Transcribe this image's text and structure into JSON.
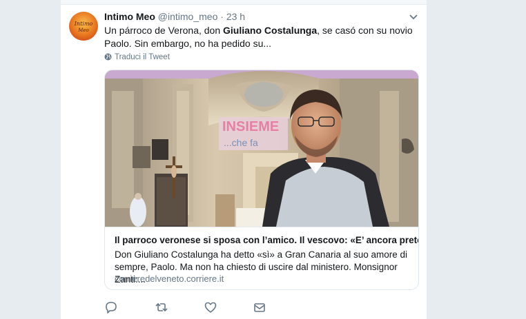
{
  "tweet": {
    "author_name": "Intimo Meo",
    "author_handle": "@intimo_meo",
    "separator": "·",
    "time": "23 h",
    "avatar_text_1": "Intimo",
    "avatar_text_2": "Meo",
    "text_before": "Un párroco de Verona, don ",
    "text_bold": "Giuliano Costalunga",
    "text_after": ", se casó con su novio Paolo. Sin embargo, no ha pedido su...",
    "translate_label": "Traduci il Tweet"
  },
  "card": {
    "image_banner_text_1": "INSIEME",
    "image_banner_text_2": "...che fa",
    "title": "Il parroco veronese si sposa con l’amico. Il vescovo: «E’ ancora prete»",
    "description": "Don Giuliano Costalunga ha detto «sì» a Gran Canaria al suo amore di sempre, Paolo. Ma non ha chiesto di uscire dal ministero. Monsignor Zanti:...",
    "domain": "corrieredelveneto.corriere.it"
  },
  "actions": {
    "icons": [
      "reply-icon",
      "retweet-icon",
      "like-icon",
      "message-icon"
    ]
  },
  "colors": {
    "text": "#14171a",
    "secondary": "#657786",
    "background": "#e6ecf0",
    "border": "#e1e8ed"
  }
}
